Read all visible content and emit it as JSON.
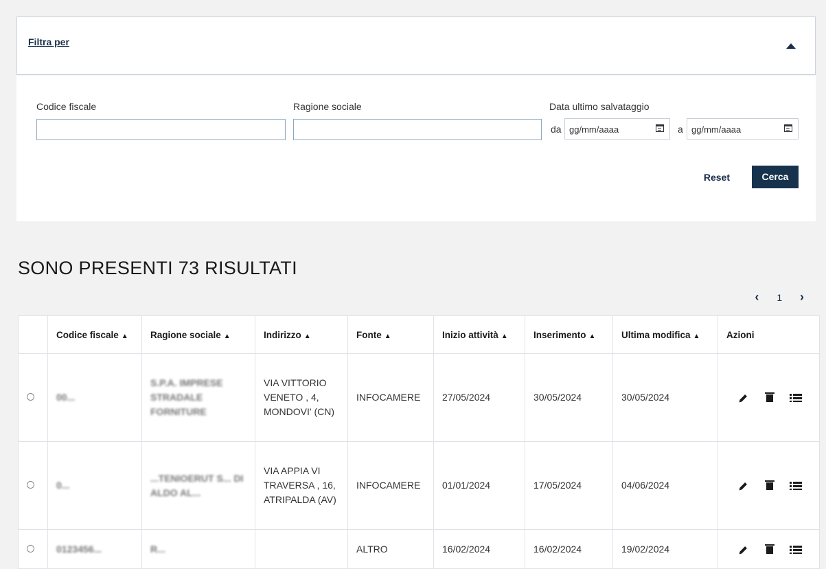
{
  "filter": {
    "toggle_label": "Filtra per",
    "codice_fiscale_label": "Codice fiscale",
    "ragione_sociale_label": "Ragione sociale",
    "data_label": "Data ultimo salvataggio",
    "da_label": "da",
    "a_label": "a",
    "date_placeholder": "gg/mm/aaaa",
    "reset_label": "Reset",
    "cerca_label": "Cerca"
  },
  "results": {
    "title": "SONO PRESENTI 73 RISULTATI",
    "page": "1"
  },
  "table": {
    "headers": [
      "Codice fiscale",
      "Ragione sociale",
      "Indirizzo",
      "Fonte",
      "Inizio attività",
      "Inserimento",
      "Ultima modifica",
      "Azioni"
    ],
    "rows": [
      {
        "codice": "00...",
        "ragione": "S.P.A. IMPRESE STRADALE FORNITURE",
        "indirizzo": "VIA VITTORIO VENETO , 4, MONDOVI' (CN)",
        "fonte": "INFOCAMERE",
        "inizio": "27/05/2024",
        "inserimento": "30/05/2024",
        "modifica": "30/05/2024"
      },
      {
        "codice": "0...",
        "ragione": "...TENIOERUT S... DI ALDO AL...",
        "indirizzo": "VIA APPIA VI TRAVERSA , 16, ATRIPALDA (AV)",
        "fonte": "INFOCAMERE",
        "inizio": "01/01/2024",
        "inserimento": "17/05/2024",
        "modifica": "04/06/2024"
      },
      {
        "codice": "0123456...",
        "ragione": "R...",
        "indirizzo": "",
        "fonte": "ALTRO",
        "inizio": "16/02/2024",
        "inserimento": "16/02/2024",
        "modifica": "19/02/2024"
      }
    ]
  }
}
